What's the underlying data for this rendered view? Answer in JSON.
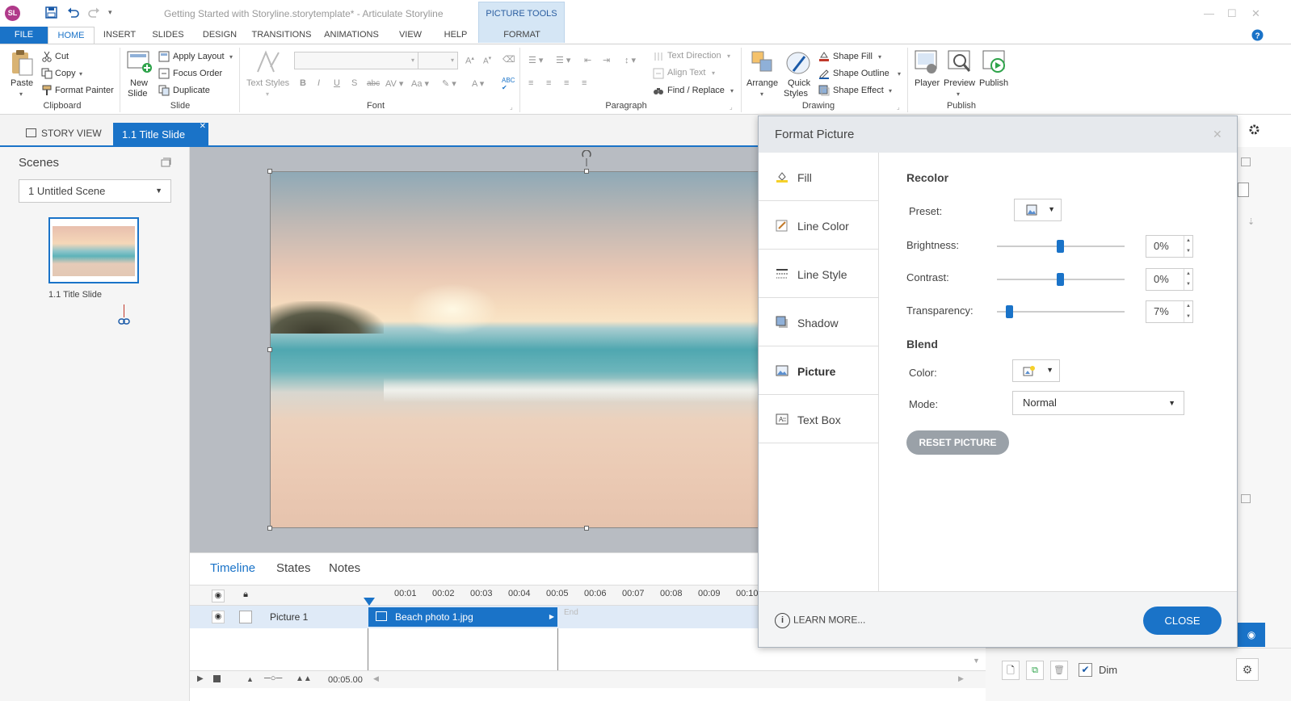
{
  "titlebar": {
    "app_logo": "SL",
    "title": "Getting Started with Storyline.storytemplate* - Articulate Storyline",
    "contextual_group": "PICTURE TOOLS"
  },
  "ribbon_tabs": [
    "FILE",
    "HOME",
    "INSERT",
    "SLIDES",
    "DESIGN",
    "TRANSITIONS",
    "ANIMATIONS",
    "VIEW",
    "HELP",
    "FORMAT"
  ],
  "ribbon": {
    "clipboard": {
      "paste": "Paste",
      "cut": "Cut",
      "copy": "Copy",
      "format_painter": "Format Painter",
      "label": "Clipboard"
    },
    "slide": {
      "new_slide_1": "New",
      "new_slide_2": "Slide",
      "apply_layout": "Apply Layout",
      "focus_order": "Focus Order",
      "duplicate": "Duplicate",
      "label": "Slide"
    },
    "font": {
      "text_styles": "Text Styles",
      "label": "Font"
    },
    "paragraph": {
      "text_direction": "Text Direction",
      "align_text": "Align Text",
      "find_replace": "Find / Replace",
      "label": "Paragraph"
    },
    "drawing": {
      "arrange": "Arrange",
      "quick_styles_1": "Quick",
      "quick_styles_2": "Styles",
      "shape_fill": "Shape Fill",
      "shape_outline": "Shape Outline",
      "shape_effect": "Shape Effect",
      "label": "Drawing"
    },
    "publish": {
      "player": "Player",
      "preview": "Preview",
      "publish": "Publish",
      "label": "Publish"
    }
  },
  "view_tabs": {
    "story_view": "STORY VIEW",
    "title_slide": "1.1 Title Slide"
  },
  "scenes": {
    "title": "Scenes",
    "selected_scene": "1 Untitled Scene",
    "slide_label": "1.1 Title Slide"
  },
  "timeline": {
    "tabs": [
      "Timeline",
      "States",
      "Notes"
    ],
    "ticks": [
      "00:01",
      "00:02",
      "00:03",
      "00:04",
      "00:05",
      "00:06",
      "00:07",
      "00:08",
      "00:09",
      "00:10"
    ],
    "row_name": "Picture 1",
    "bar_label": "Beach photo 1.jpg",
    "end_label": "End",
    "duration": "00:05.00"
  },
  "bottom_right": {
    "dim_label": "Dim"
  },
  "dialog": {
    "title": "Format Picture",
    "nav": [
      {
        "label": "Fill",
        "icon": "fill-bucket-icon"
      },
      {
        "label": "Line Color",
        "icon": "line-color-icon"
      },
      {
        "label": "Line Style",
        "icon": "line-style-icon"
      },
      {
        "label": "Shadow",
        "icon": "shadow-icon"
      },
      {
        "label": "Picture",
        "icon": "picture-icon"
      },
      {
        "label": "Text Box",
        "icon": "text-box-icon"
      }
    ],
    "active_nav": "Picture",
    "recolor": {
      "title": "Recolor",
      "preset_label": "Preset:",
      "brightness_label": "Brightness:",
      "brightness_value": "0%",
      "contrast_label": "Contrast:",
      "contrast_value": "0%",
      "transparency_label": "Transparency:",
      "transparency_value": "7%"
    },
    "blend": {
      "title": "Blend",
      "color_label": "Color:",
      "mode_label": "Mode:",
      "mode_value": "Normal"
    },
    "reset_button": "RESET PICTURE",
    "learn_more": "LEARN MORE...",
    "close_button": "CLOSE"
  },
  "colors": {
    "accent": "#1a73c8",
    "file_tab": "#1a73c8",
    "reset_button": "#9aa1a8"
  }
}
